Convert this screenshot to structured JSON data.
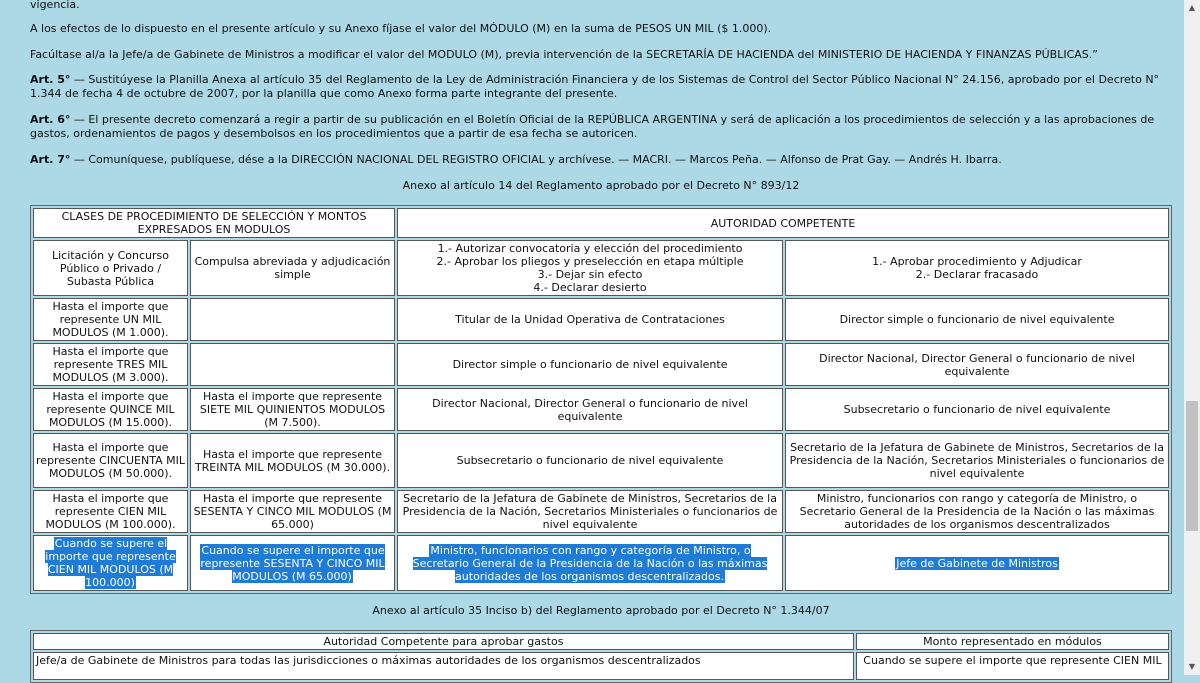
{
  "paragraphs": {
    "p0": "vigencia.",
    "p1": "A los efectos de lo dispuesto en el presente artículo y su Anexo fíjase el valor del MÓDULO (M) en la suma de PESOS UN MIL ($ 1.000).",
    "p2": "Facúltase al/a la Jefe/a de Gabinete de Ministros a modificar el valor del MODULO (M), previa intervención de la SECRETARÍA DE HACIENDA del MINISTERIO DE HACIENDA Y FINANZAS PÚBLICAS.”",
    "art5_label": "Art. 5°",
    "art5_text": " — Sustitúyese la Planilla Anexa al artículo 35 del Reglamento de la Ley de Administración Financiera y de los Sistemas de Control del Sector Público Nacional N° 24.156, aprobado por el Decreto N° 1.344 de fecha 4 de octubre de 2007, por la planilla que como Anexo forma parte integrante del presente.",
    "art6_label": "Art. 6°",
    "art6_text": " — El presente decreto comenzará a regir a partir de su publicación en el Boletín Oficial de la REPÚBLICA ARGENTINA y será de aplicación a los procedimientos de selección y a las aprobaciones de gastos, ordenamientos de pagos y desembolsos en los procedimientos que a partir de esa fecha se autoricen.",
    "art7_label": "Art. 7°",
    "art7_text": " — Comuníquese, publíquese, dése a la DIRECCIÓN NACIONAL DEL REGISTRO OFICIAL y archívese. — MACRI. — Marcos Peña. — Alfonso de Prat Gay. — Andrés H. Ibarra."
  },
  "caption1": "Anexo al artículo 14 del Reglamento aprobado por el Decreto N° 893/12",
  "table1": {
    "h_left": "CLASES DE PROCEDIMIENTO DE SELECCIÓN Y MONTOS EXPRESADOS EN MODULOS",
    "h_right": "AUTORIDAD COMPETENTE",
    "r0": [
      "Licitación y Concurso Público o Privado / Subasta Pública",
      "Compulsa abreviada y adjudicación simple",
      "1.- Autorizar convocatoria y elección del procedimiento\n2.- Aprobar los pliegos y preselección en etapa múltiple\n3.- Dejar sin efecto\n4.- Declarar desierto",
      "1.- Aprobar procedimiento y Adjudicar\n2.- Declarar fracasado"
    ],
    "r1": [
      "Hasta el importe que represente UN MIL MODULOS (M 1.000).",
      "",
      "Titular de la Unidad Operativa de Contrataciones",
      "Director simple o funcionario de nivel equivalente"
    ],
    "r2": [
      "Hasta el importe que represente TRES MIL MODULOS (M 3.000).",
      "",
      "Director simple o funcionario de nivel equivalente",
      "Director Nacional, Director General o funcionario de nivel equivalente"
    ],
    "r3": [
      "Hasta el importe que represente QUINCE MIL MODULOS (M 15.000).",
      "Hasta el importe que represente SIETE MIL QUINIENTOS MODULOS (M 7.500).",
      "Director Nacional, Director General o funcionario de nivel equivalente",
      "Subsecretario o funcionario de nivel equivalente"
    ],
    "r4": [
      "Hasta el importe que represente CINCUENTA MIL MODULOS (M 50.000).",
      "Hasta el importe que represente TREINTA MIL MODULOS (M 30.000).",
      "Subsecretario o funcionario de nivel equivalente",
      "Secretario de la Jefatura de Gabinete de Ministros, Secretarios de la Presidencia de la Nación, Secretarios Ministeriales o funcionarios de nivel equivalente"
    ],
    "r5": [
      "Hasta el importe que represente CIEN MIL MODULOS (M 100.000).",
      "Hasta el importe que represente SESENTA Y CINCO MIL MODULOS (M 65.000)",
      "Secretario de la Jefatura de Gabinete de Ministros, Secretarios de la Presidencia de la Nación, Secretarios Ministeriales o funcionarios de nivel equivalente",
      "Ministro, funcionarios con rango y categoría de Ministro, o Secretario General de la Presidencia de la Nación o las máximas autoridades de los organismos descentralizados"
    ],
    "r6": [
      "Cuando se supere el importe que represente CIEN MIL MODULOS (M 100.000)",
      "Cuando se supere el importe que represente SESENTA Y CINCO MIL MODULOS (M 65.000)",
      "Ministro, funcionarios con rango y categoría de Ministro, o Secretario General de la Presidencia de la Nación o las máximas autoridades de los organismos descentralizados.",
      "Jefe de Gabinete de Ministros"
    ]
  },
  "caption2": "Anexo al artículo 35 Inciso b) del Reglamento aprobado por el Decreto N° 1.344/07",
  "table2": {
    "h_left": "Autoridad Competente para aprobar gastos",
    "h_right": "Monto representado en módulos",
    "r0_left": "Jefe/a de Gabinete de Ministros para todas las jurisdicciones o máximas autoridades de los organismos descentralizados",
    "r0_right": "Cuando se supere el importe que represente CIEN MIL"
  },
  "colors": {
    "background": "#add8e6",
    "highlight": "#1e7bd6"
  },
  "scrollbar": {
    "position_fraction": 0.75
  }
}
